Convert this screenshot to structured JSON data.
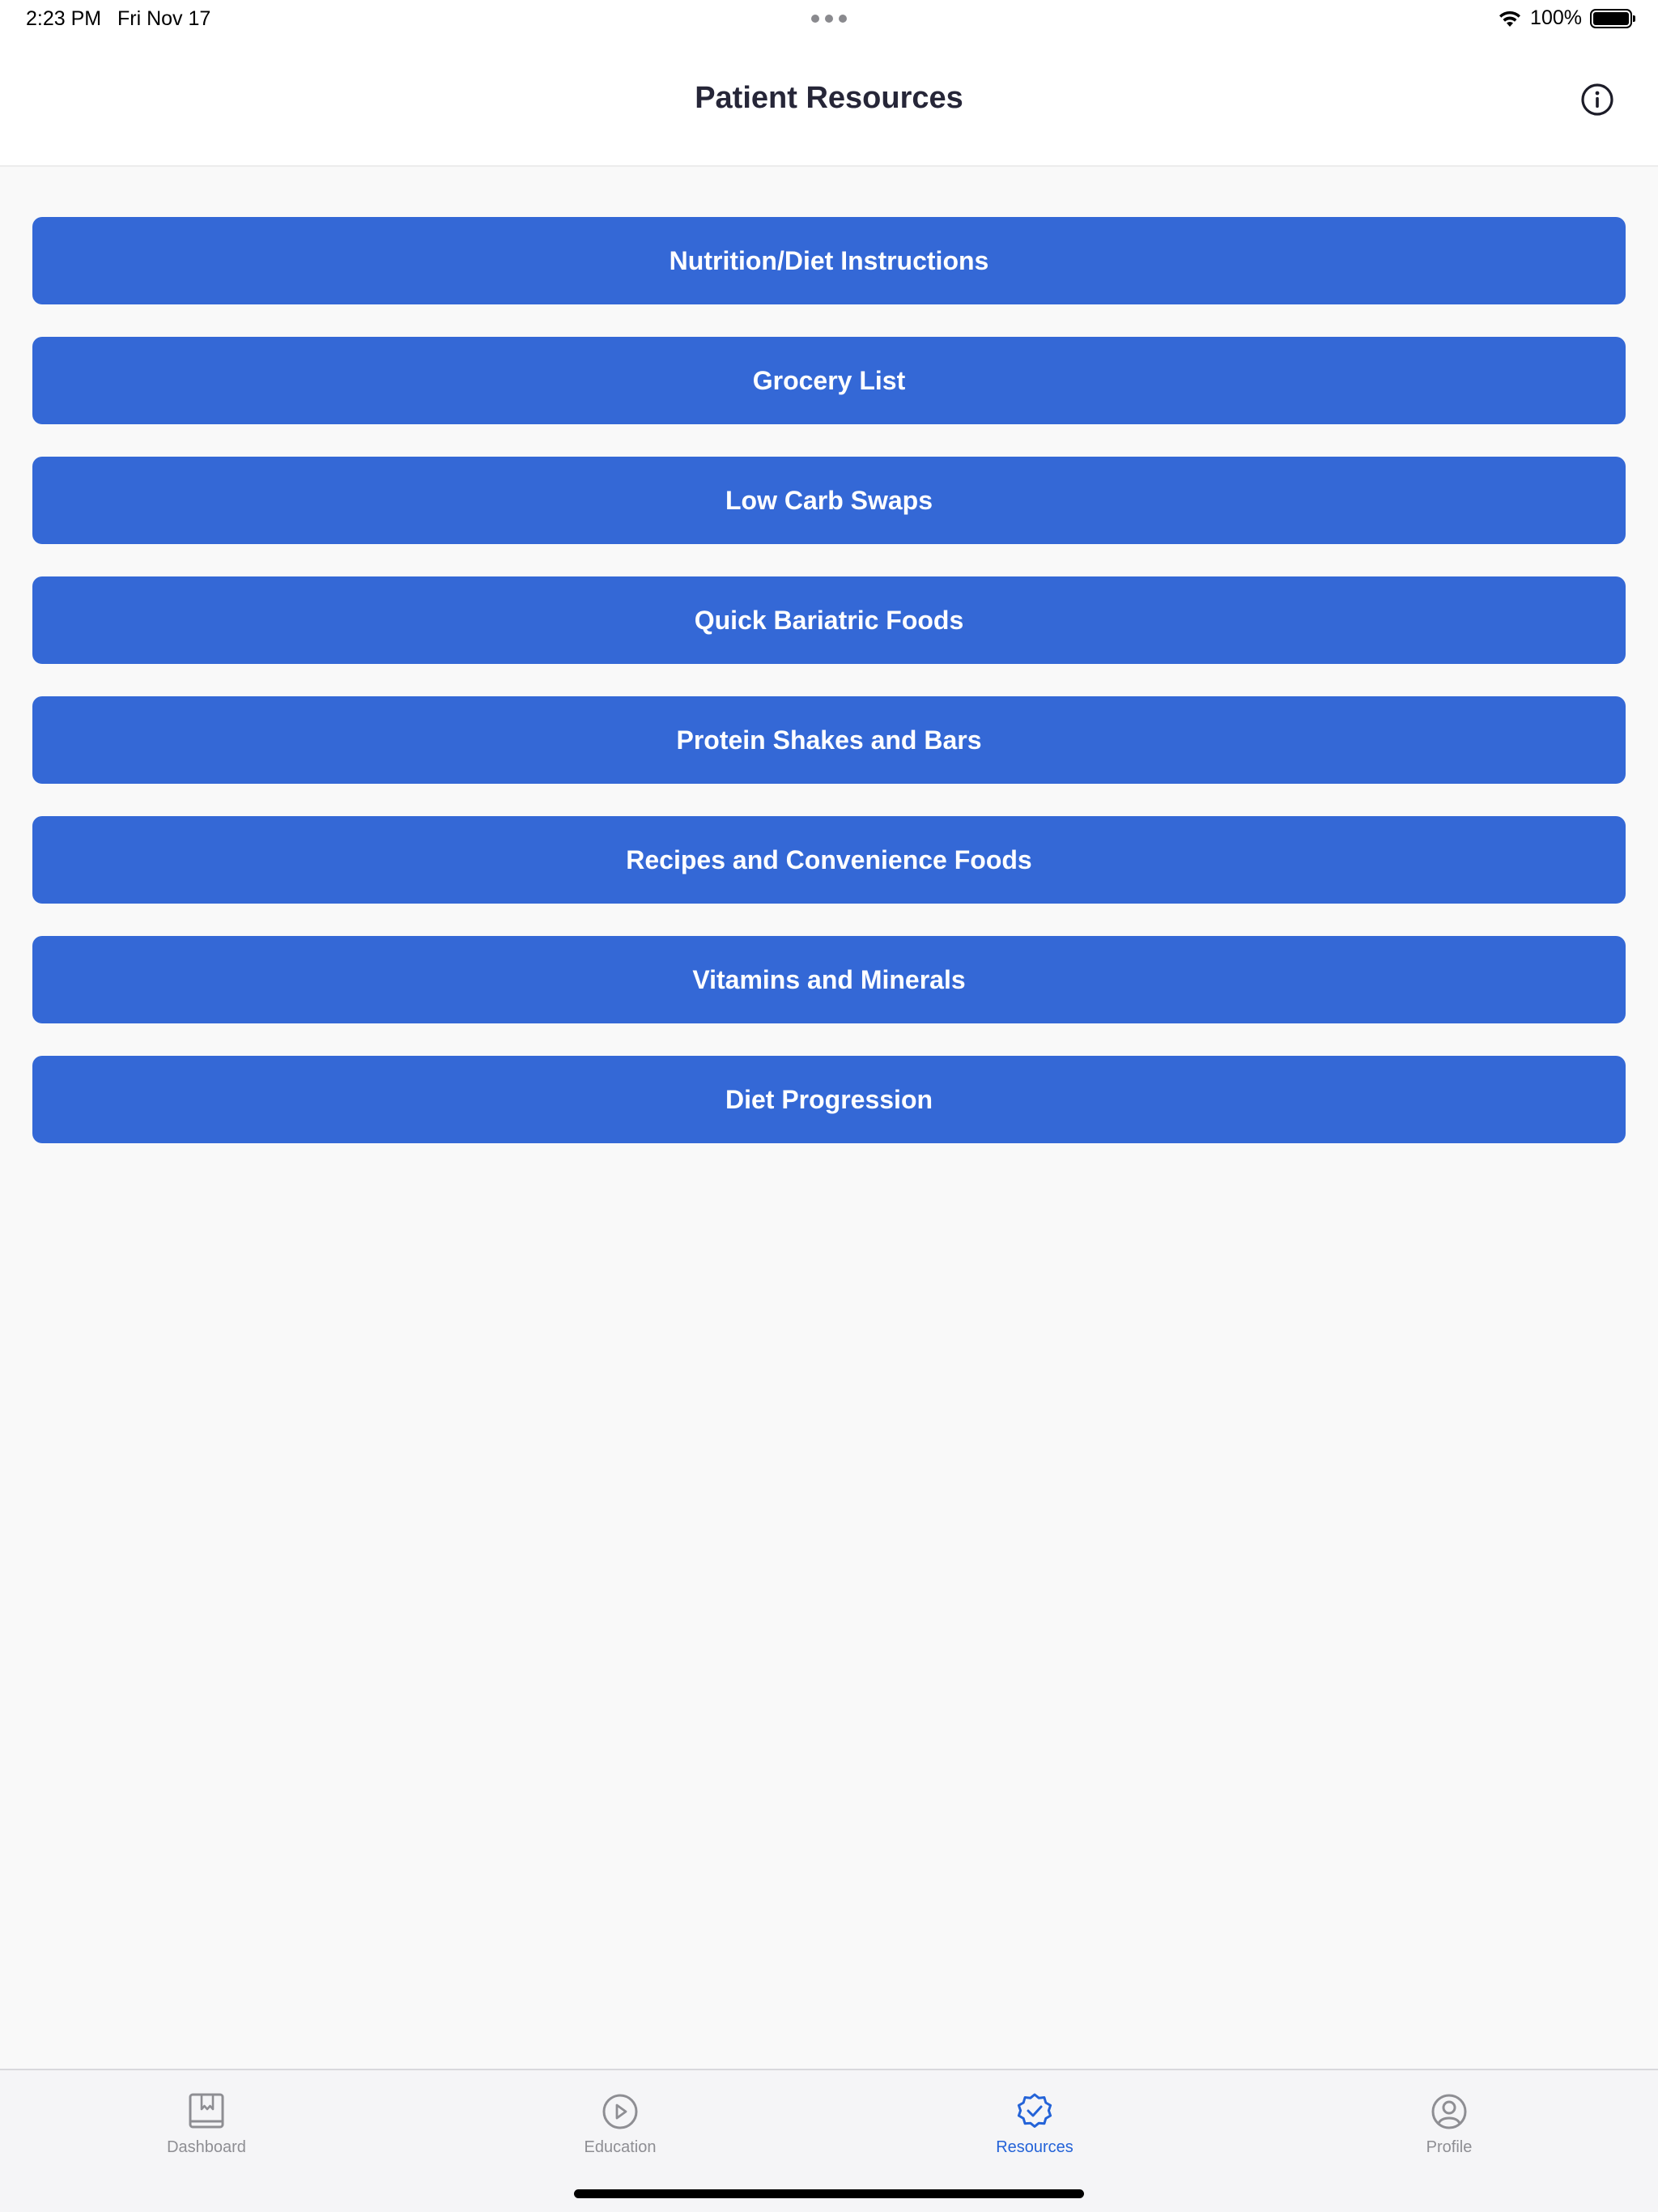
{
  "status_bar": {
    "time": "2:23 PM",
    "date": "Fri Nov 17",
    "battery": "100%"
  },
  "header": {
    "title": "Patient Resources",
    "info_icon": "info-circle-icon"
  },
  "resources": [
    {
      "label": "Nutrition/Diet Instructions"
    },
    {
      "label": "Grocery List"
    },
    {
      "label": "Low Carb Swaps"
    },
    {
      "label": "Quick Bariatric Foods"
    },
    {
      "label": "Protein Shakes and Bars"
    },
    {
      "label": "Recipes and Convenience Foods"
    },
    {
      "label": "Vitamins and Minerals"
    },
    {
      "label": "Diet Progression"
    }
  ],
  "tab_bar": {
    "tabs": [
      {
        "label": "Dashboard",
        "icon": "dashboard-icon",
        "active": false
      },
      {
        "label": "Education",
        "icon": "play-circle-icon",
        "active": false
      },
      {
        "label": "Resources",
        "icon": "verified-badge-icon",
        "active": true
      },
      {
        "label": "Profile",
        "icon": "profile-icon",
        "active": false
      }
    ]
  },
  "colors": {
    "accent": "#3468d6",
    "active_tab": "#2463d8",
    "inactive_tab": "#8e8e93",
    "background": "#f9f9f9"
  }
}
